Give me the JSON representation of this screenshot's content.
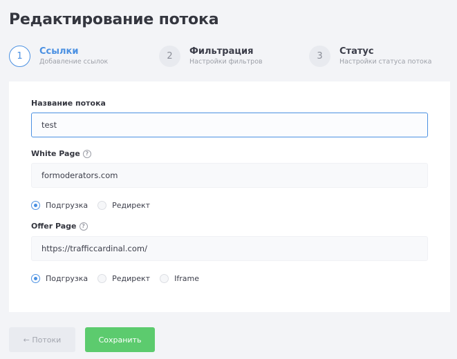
{
  "page": {
    "title": "Редактирование потока"
  },
  "steps": [
    {
      "number": "1",
      "title": "Ссылки",
      "subtitle": "Добавление ссылок",
      "state": "active"
    },
    {
      "number": "2",
      "title": "Фильтрация",
      "subtitle": "Настройки фильтров",
      "state": "inactive"
    },
    {
      "number": "3",
      "title": "Статус",
      "subtitle": "Настройки статуса потока",
      "state": "inactive"
    }
  ],
  "form": {
    "stream_name": {
      "label": "Название потока",
      "value": "test"
    },
    "white_page": {
      "label": "White Page",
      "help_icon": "question-circle-icon",
      "value": "formoderators.com",
      "options": [
        {
          "label": "Подгрузка",
          "checked": true
        },
        {
          "label": "Редирект",
          "checked": false
        }
      ]
    },
    "offer_page": {
      "label": "Offer Page",
      "help_icon": "question-circle-icon",
      "value": "https://trafficcardinal.com/",
      "options": [
        {
          "label": "Подгрузка",
          "checked": true
        },
        {
          "label": "Редирект",
          "checked": false
        },
        {
          "label": "Iframe",
          "checked": false
        }
      ]
    }
  },
  "buttons": {
    "back": "← Потоки",
    "save": "Сохранить"
  },
  "colors": {
    "accent": "#4a90e2",
    "save_button": "#5ccb6e",
    "background": "#f3f4f7",
    "card": "#ffffff"
  }
}
